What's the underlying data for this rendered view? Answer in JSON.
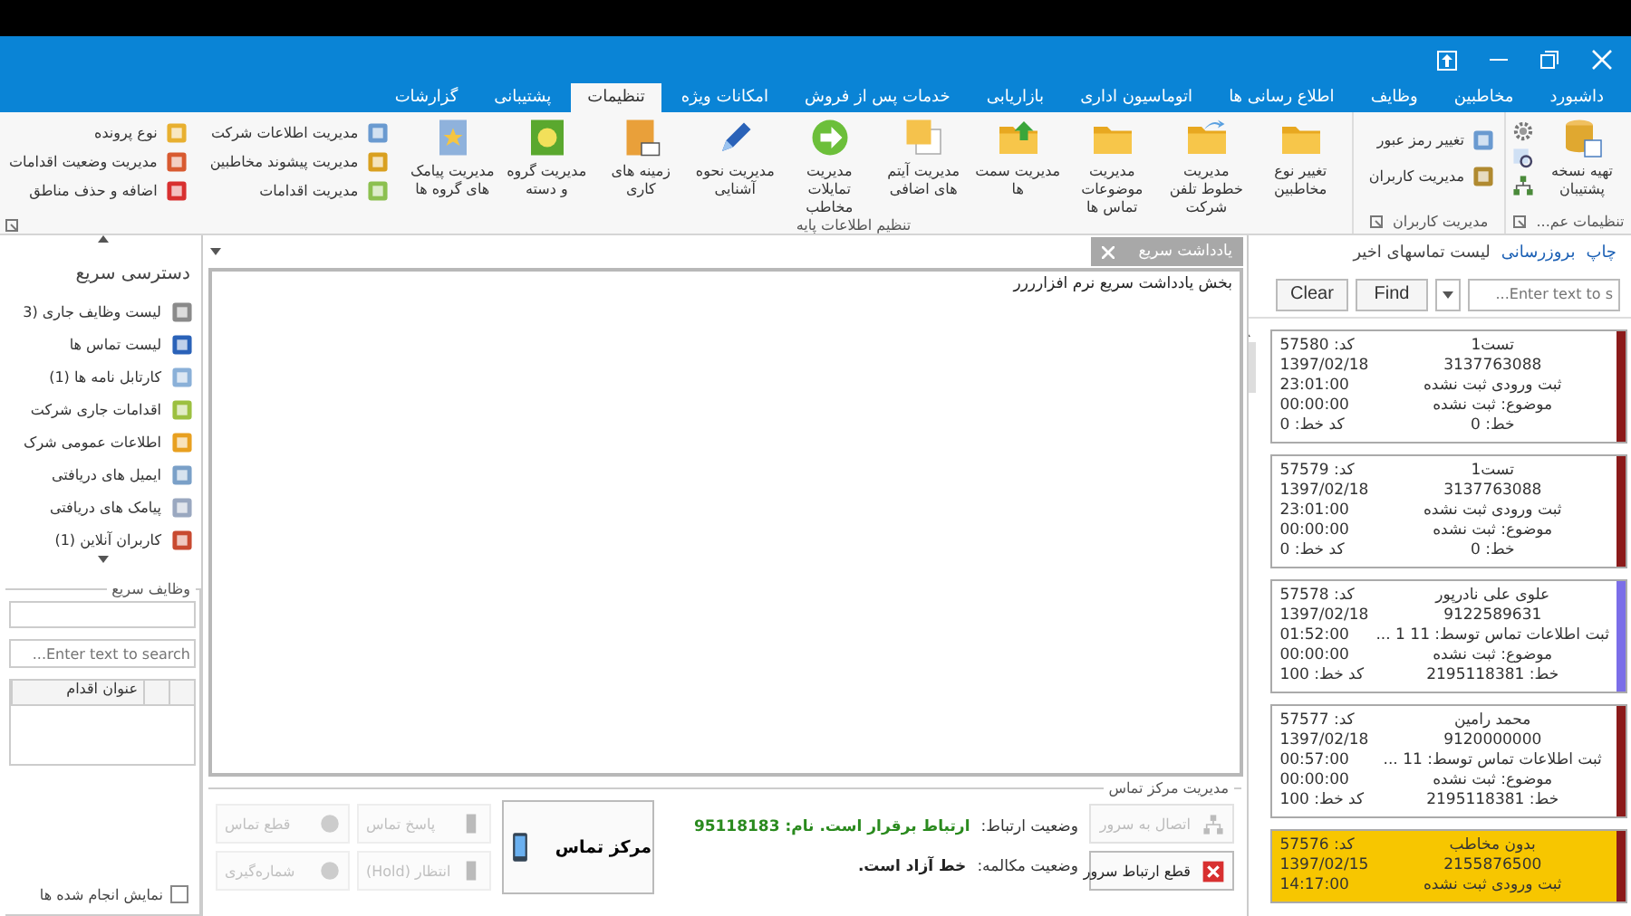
{
  "tabs": [
    {
      "label": "داشبورد",
      "selected": false
    },
    {
      "label": "مخاطبین",
      "selected": false
    },
    {
      "label": "وظایف",
      "selected": false
    },
    {
      "label": "اطلاع رسانی ها",
      "selected": false
    },
    {
      "label": "اتوماسیون اداری",
      "selected": false
    },
    {
      "label": "بازاریابی",
      "selected": false
    },
    {
      "label": "خدمات پس از فروش",
      "selected": false
    },
    {
      "label": "امکانات ویژه",
      "selected": false
    },
    {
      "label": "تنظیمات",
      "selected": true
    },
    {
      "label": "پشتیبانی",
      "selected": false
    },
    {
      "label": "گزارشات",
      "selected": false
    }
  ],
  "ribbon": {
    "general": {
      "title": "تنظیمات عم...",
      "large_button": "تهیه نسخه پشتیبان"
    },
    "users": {
      "title": "مدیریت کاربران",
      "items": [
        "تغییر رمز عبور",
        "مدیریت کاربران"
      ]
    },
    "base_info": {
      "title": "تنظیم اطلاعات پایه",
      "large_buttons": [
        "تغییر نوع مخاطبین",
        "مدیریت خطوط تلفن شرکت",
        "مدیریت موضوعات تماس ها",
        "مدیریت سمت ها",
        "مدیریت آیتم های اضافی",
        "مدیریت تمایلات مخاطب",
        "مدیریت نحوه آشنایی",
        "زمینه های کاری",
        "مدیریت گروه و دسته",
        "مدیریت پیامک های گروه ها"
      ],
      "small_columns": [
        [
          "مدیریت اطلاعات شرکت",
          "مدیریت پیشوند مخاطبین",
          "مدیریت اقدامات"
        ],
        [
          "نوع پرونده",
          "مدیریت وضعیت اقدامات",
          "اضافه و حذف مناطق"
        ]
      ]
    }
  },
  "recent_calls": {
    "links": [
      "چاپ",
      "بروزرسانی"
    ],
    "title": "لیست تماسهای اخیر",
    "search": {
      "placeholder": "Enter text to s..."
    },
    "buttons": [
      "Find",
      "Clear"
    ],
    "cards": [
      {
        "name": "تست1",
        "phone": "3137763088",
        "status": "ثبت ورودی ثبت نشده",
        "subject": "موضوع: ثبت نشده",
        "line": "خط: 0",
        "code": "کد: 57580",
        "date": "1397/02/18",
        "time": "23:01:00",
        "duration": "00:00:00",
        "line_code": "کد خط: 0",
        "color": "#8b1a1a",
        "highlighted": false
      },
      {
        "name": "تست1",
        "phone": "3137763088",
        "status": "ثبت ورودی ثبت نشده",
        "subject": "موضوع: ثبت نشده",
        "line": "خط: 0",
        "code": "کد: 57579",
        "date": "1397/02/18",
        "time": "23:01:00",
        "duration": "00:00:00",
        "line_code": "کد خط: 0",
        "color": "#8b1a1a",
        "highlighted": false
      },
      {
        "name": "علوی علی نادرپور",
        "phone": "9122589631",
        "status": "ثبت اطلاعات تماس توسط: 11 1 ...",
        "subject": "موضوع: ثبت نشده",
        "line": "خط: 2195118381",
        "code": "کد: 57578",
        "date": "1397/02/18",
        "time": "01:52:00",
        "duration": "00:00:00",
        "line_code": "کد خط: 100",
        "color": "#7b6ee8",
        "highlighted": false
      },
      {
        "name": "محمد رامین",
        "phone": "9120000000",
        "status": "ثبت اطلاعات تماس توسط: 11 ...",
        "subject": "موضوع: ثبت نشده",
        "line": "خط: 2195118381",
        "code": "کد: 57577",
        "date": "1397/02/18",
        "time": "00:57:00",
        "duration": "00:00:00",
        "line_code": "کد خط: 100",
        "color": "#8b1a1a",
        "highlighted": false
      },
      {
        "name": "بدون مخاطب",
        "phone": "2155876500",
        "status": "ثبت ورودی ثبت نشده",
        "code": "کد: 57576",
        "date": "1397/02/15",
        "time": "14:17:00",
        "color": "#8b1a1a",
        "highlighted": true
      }
    ]
  },
  "note": {
    "tab": "یادداشت سریع",
    "text": "بخش یادداشت سریع نرم افزارررر"
  },
  "call_center": {
    "title": "مدیریت مرکز تماس",
    "server_buttons": [
      {
        "label": "اتصال به سرور",
        "disabled": true
      },
      {
        "label": "قطع ارتباط سرور",
        "disabled": false
      }
    ],
    "status": [
      {
        "label": "وضعیت ارتباط:",
        "value": "ارتباط برقرار است. نام: 95118183",
        "kind": "ok"
      },
      {
        "label": "وضعیت مکالمه:",
        "value": "خط آزاد است.",
        "kind": "plain"
      }
    ],
    "main_button": "مرکز تماس",
    "call_buttons": [
      {
        "label": "پاسخ تماس",
        "disabled": true
      },
      {
        "label": "قطع تماس",
        "disabled": true
      },
      {
        "label": "انتظار (Hold)",
        "disabled": true
      },
      {
        "label": "شماره‌گیری",
        "disabled": true
      }
    ]
  },
  "quick_access": {
    "title": "دسترسی سریع",
    "items": [
      "لیست وظایف جاری (3",
      "لیست تماس ها",
      "کارتابل نامه ها (1)",
      "اقدامات جاری شرکت",
      "اطلاعات عمومی شرک",
      "ایمیل های دریافتی",
      "پیامک های دریافتی",
      "کاربران آنلاین (1)"
    ]
  },
  "quick_tasks": {
    "title": "وظایف سریع",
    "search": {
      "placeholder": "Enter text to search..."
    },
    "columns": [
      "عنوان اقدام"
    ],
    "show_done": {
      "label": "نمایش انجام شده ها",
      "checked": false
    }
  }
}
